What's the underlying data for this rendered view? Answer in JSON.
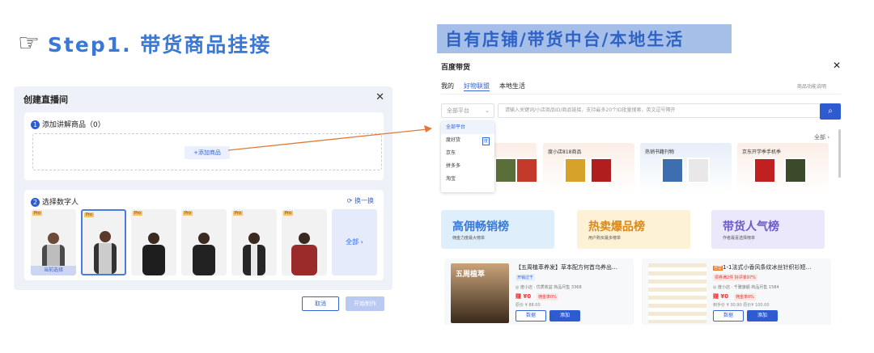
{
  "step": {
    "hand_icon": "pointing-hand-icon",
    "title": "Step1. 带货商品挂接"
  },
  "right_title": "自有店铺/带货中台/本地生活",
  "create_dialog": {
    "title": "创建直播间",
    "section1": {
      "num": "1",
      "title": "添加讲解商品（0）",
      "add_button": "+添加商品"
    },
    "section2": {
      "num": "2",
      "title": "选择数字人",
      "swap": "换一换",
      "pro_badge": "Pro",
      "current_label": "当前选择",
      "all_label": "全部 ›"
    },
    "cancel": "取消",
    "start": "开始制作"
  },
  "baidu": {
    "title": "百度带货",
    "tabs": [
      "我的",
      "好物联盟",
      "本地生活"
    ],
    "help": "商品功能说明",
    "select_placeholder": "全部平台",
    "search_placeholder": "请输入关键词/小店商品ID/商品链接，支持最多20个ID批量搜索，英文逗号隔开",
    "dropdown": [
      "全部平台",
      "度好货",
      "京东",
      "拼多多",
      "淘宝"
    ],
    "dropdown_badge": "度",
    "all_link": "全部 ›",
    "cards": [
      "度小店818商品",
      "热销书籍刊物",
      "京东开学季手机季"
    ],
    "ranks": [
      {
        "title": "高佣畅销榜",
        "sub": "佣金力度最大榜单",
        "color": "#dfeefb",
        "fg": "#3a78d6"
      },
      {
        "title": "热卖爆品榜",
        "sub": "用户购买最多榜单",
        "color": "#fdf1d6",
        "fg": "#d98a1a"
      },
      {
        "title": "带货人气榜",
        "sub": "作者最喜选择榜单",
        "color": "#ece8fb",
        "fg": "#6a5acd"
      }
    ],
    "products": [
      {
        "title": "【五周植萃养发】草本配方何首乌养出…",
        "tag": "开销过千",
        "meta": "◎ 度小店 · 优质收益    商品月售 3368",
        "price": "赚 ¥0",
        "comm": "佣金率0%",
        "orig": "原价 ¥ 88.00",
        "btn1": "数据",
        "btn2": "添加",
        "img_text": "五周植萃"
      },
      {
        "title": "1-1法式小香风条纹冰丝针织衫短…",
        "badge": "自营",
        "tag": "领券满2件 好评率97%",
        "meta": "◎ 度小店 · 千雅旗舰    商品月售 1584",
        "price": "赚 ¥0",
        "comm": "佣金率0%",
        "orig": "到手价 ¥ 30.90  原价¥ 100.00",
        "btn1": "数据",
        "btn2": "添加"
      }
    ]
  }
}
